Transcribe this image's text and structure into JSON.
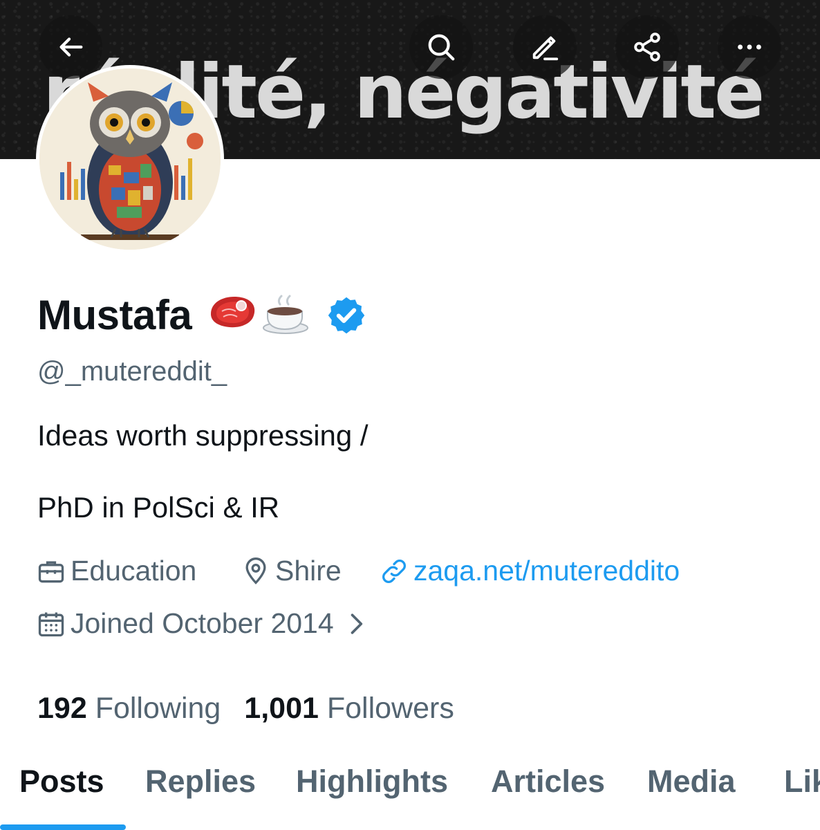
{
  "banner": {
    "text": "réalité, négativité",
    "buttons": {
      "back": "back-arrow-icon",
      "search": "search-icon",
      "edit": "edit-pencil-icon",
      "share": "share-icon",
      "more": "more-icon"
    }
  },
  "profile": {
    "name": "Mustafa",
    "emojis": "🥩☕",
    "verified": true,
    "handle": "@_mutereddit_",
    "bio_line1": "Ideas worth suppressing /",
    "bio_line2": "PhD in PolSci & IR",
    "category": "Education",
    "location": "Shire",
    "website": "zaqa.net/mutereddito",
    "joined": "Joined October 2014"
  },
  "stats": {
    "following_count": "192",
    "following_label": "Following",
    "followers_count": "1,001",
    "followers_label": "Followers"
  },
  "tabs": [
    {
      "label": "Posts",
      "active": true
    },
    {
      "label": "Replies"
    },
    {
      "label": "Highlights"
    },
    {
      "label": "Articles"
    },
    {
      "label": "Media"
    },
    {
      "label": "Likes"
    }
  ],
  "colors": {
    "accent": "#1d9bf0",
    "text_primary": "#0f1419",
    "text_secondary": "#536471"
  }
}
